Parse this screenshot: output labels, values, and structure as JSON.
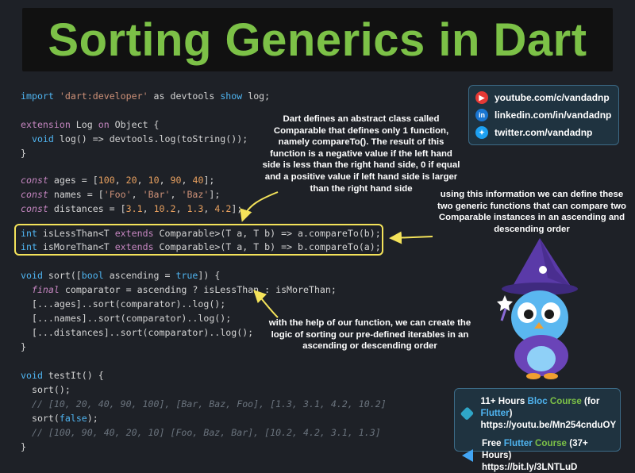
{
  "title": "Sorting Generics in Dart",
  "code": {
    "l1": [
      "import",
      " ",
      "'dart:developer'",
      " as devtools ",
      "show",
      " log;"
    ],
    "l2": [
      "extension",
      " Log ",
      "on",
      " Object {"
    ],
    "l3": [
      "  ",
      "void",
      " log() => devtools.log(toString());"
    ],
    "l4": "}",
    "l5": [
      "const",
      " ages = [",
      "100",
      ", ",
      "20",
      ", ",
      "10",
      ", ",
      "90",
      ", ",
      "40",
      "];"
    ],
    "l6": [
      "const",
      " names = [",
      "'Foo'",
      ", ",
      "'Bar'",
      ", ",
      "'Baz'",
      "];"
    ],
    "l7": [
      "const",
      " distances = [",
      "3.1",
      ", ",
      "10.2",
      ", ",
      "1.3",
      ", ",
      "4.2",
      "];"
    ],
    "l8": [
      "int",
      " isLessThan<T ",
      "extends",
      " Comparable>(T a, T b) => a.compareTo(b);"
    ],
    "l9": [
      "int",
      " isMoreThan<T ",
      "extends",
      " Comparable>(T a, T b) => b.compareTo(a);"
    ],
    "l10": [
      "void",
      " sort([",
      "bool",
      " ascending = ",
      "true",
      "]) {"
    ],
    "l11": [
      "  ",
      "final",
      " comparator = ascending ? isLessThan : isMoreThan;"
    ],
    "l12": "  [...ages]..sort(comparator)..log();",
    "l13": "  [...names]..sort(comparator)..log();",
    "l14": "  [...distances]..sort(comparator)..log();",
    "l15": "}",
    "l16": [
      "void",
      " testIt() {"
    ],
    "l17": "  sort();",
    "l18": "  // [10, 20, 40, 90, 100], [Bar, Baz, Foo], [1.3, 3.1, 4.2, 10.2]",
    "l19": [
      "  sort(",
      "false",
      ");"
    ],
    "l20": "  // [100, 90, 40, 20, 10] [Foo, Baz, Bar], [10.2, 4.2, 3.1, 1.3]",
    "l21": "}"
  },
  "notes": {
    "n1": "Dart defines an abstract class called Comparable that defines only 1 function, namely compareTo(). The result of this function is a negative value if the left hand side is less than the right hand side, 0 if equal and a positive value if left hand side is larger than the right hand side",
    "n2": "using this information we can define these two generic functions that can compare two Comparable instances in an ascending and descending order",
    "n3": "with the help of our function, we can create the logic of sorting our pre-defined iterables in an ascending or descending order"
  },
  "social": [
    {
      "icon": "youtube-icon",
      "text": "youtube.com/c/vandadnp"
    },
    {
      "icon": "linkedin-icon",
      "text": "linkedin.com/in/vandadnp"
    },
    {
      "icon": "twitter-icon",
      "text": "twitter.com/vandadnp"
    }
  ],
  "courses": {
    "c1_pre": "11+ Hours ",
    "c1_blue": "Bloc",
    " c1_mid": "",
    "c1_green": "Course",
    "c1_post": " (for ",
    "c1_flutter": "Flutter",
    "c1_end": ")",
    "c1_url": "https://youtu.be/Mn254cnduOY",
    "c2_pre": "Free ",
    "c2_blue": "Flutter",
    "c2_green": "Course",
    "c2_post": " (37+ Hours)",
    "c2_url": "https://bit.ly/3LNTLuD"
  },
  "colors": {
    "accent_green": "#7cc147",
    "accent_blue": "#4fb4f0",
    "highlight": "#f4e35a"
  }
}
